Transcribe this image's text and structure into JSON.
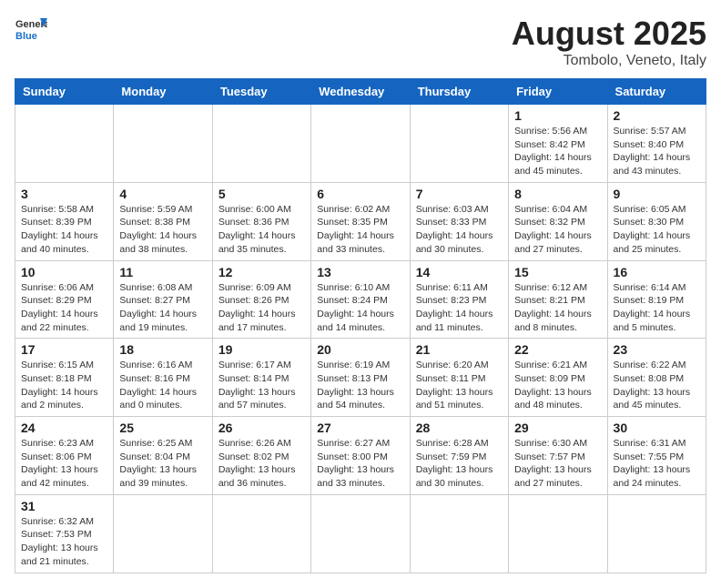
{
  "logo": {
    "text_general": "General",
    "text_blue": "Blue"
  },
  "title": "August 2025",
  "subtitle": "Tombolo, Veneto, Italy",
  "days_of_week": [
    "Sunday",
    "Monday",
    "Tuesday",
    "Wednesday",
    "Thursday",
    "Friday",
    "Saturday"
  ],
  "weeks": [
    [
      {
        "day": "",
        "info": ""
      },
      {
        "day": "",
        "info": ""
      },
      {
        "day": "",
        "info": ""
      },
      {
        "day": "",
        "info": ""
      },
      {
        "day": "",
        "info": ""
      },
      {
        "day": "1",
        "info": "Sunrise: 5:56 AM\nSunset: 8:42 PM\nDaylight: 14 hours and 45 minutes."
      },
      {
        "day": "2",
        "info": "Sunrise: 5:57 AM\nSunset: 8:40 PM\nDaylight: 14 hours and 43 minutes."
      }
    ],
    [
      {
        "day": "3",
        "info": "Sunrise: 5:58 AM\nSunset: 8:39 PM\nDaylight: 14 hours and 40 minutes."
      },
      {
        "day": "4",
        "info": "Sunrise: 5:59 AM\nSunset: 8:38 PM\nDaylight: 14 hours and 38 minutes."
      },
      {
        "day": "5",
        "info": "Sunrise: 6:00 AM\nSunset: 8:36 PM\nDaylight: 14 hours and 35 minutes."
      },
      {
        "day": "6",
        "info": "Sunrise: 6:02 AM\nSunset: 8:35 PM\nDaylight: 14 hours and 33 minutes."
      },
      {
        "day": "7",
        "info": "Sunrise: 6:03 AM\nSunset: 8:33 PM\nDaylight: 14 hours and 30 minutes."
      },
      {
        "day": "8",
        "info": "Sunrise: 6:04 AM\nSunset: 8:32 PM\nDaylight: 14 hours and 27 minutes."
      },
      {
        "day": "9",
        "info": "Sunrise: 6:05 AM\nSunset: 8:30 PM\nDaylight: 14 hours and 25 minutes."
      }
    ],
    [
      {
        "day": "10",
        "info": "Sunrise: 6:06 AM\nSunset: 8:29 PM\nDaylight: 14 hours and 22 minutes."
      },
      {
        "day": "11",
        "info": "Sunrise: 6:08 AM\nSunset: 8:27 PM\nDaylight: 14 hours and 19 minutes."
      },
      {
        "day": "12",
        "info": "Sunrise: 6:09 AM\nSunset: 8:26 PM\nDaylight: 14 hours and 17 minutes."
      },
      {
        "day": "13",
        "info": "Sunrise: 6:10 AM\nSunset: 8:24 PM\nDaylight: 14 hours and 14 minutes."
      },
      {
        "day": "14",
        "info": "Sunrise: 6:11 AM\nSunset: 8:23 PM\nDaylight: 14 hours and 11 minutes."
      },
      {
        "day": "15",
        "info": "Sunrise: 6:12 AM\nSunset: 8:21 PM\nDaylight: 14 hours and 8 minutes."
      },
      {
        "day": "16",
        "info": "Sunrise: 6:14 AM\nSunset: 8:19 PM\nDaylight: 14 hours and 5 minutes."
      }
    ],
    [
      {
        "day": "17",
        "info": "Sunrise: 6:15 AM\nSunset: 8:18 PM\nDaylight: 14 hours and 2 minutes."
      },
      {
        "day": "18",
        "info": "Sunrise: 6:16 AM\nSunset: 8:16 PM\nDaylight: 14 hours and 0 minutes."
      },
      {
        "day": "19",
        "info": "Sunrise: 6:17 AM\nSunset: 8:14 PM\nDaylight: 13 hours and 57 minutes."
      },
      {
        "day": "20",
        "info": "Sunrise: 6:19 AM\nSunset: 8:13 PM\nDaylight: 13 hours and 54 minutes."
      },
      {
        "day": "21",
        "info": "Sunrise: 6:20 AM\nSunset: 8:11 PM\nDaylight: 13 hours and 51 minutes."
      },
      {
        "day": "22",
        "info": "Sunrise: 6:21 AM\nSunset: 8:09 PM\nDaylight: 13 hours and 48 minutes."
      },
      {
        "day": "23",
        "info": "Sunrise: 6:22 AM\nSunset: 8:08 PM\nDaylight: 13 hours and 45 minutes."
      }
    ],
    [
      {
        "day": "24",
        "info": "Sunrise: 6:23 AM\nSunset: 8:06 PM\nDaylight: 13 hours and 42 minutes."
      },
      {
        "day": "25",
        "info": "Sunrise: 6:25 AM\nSunset: 8:04 PM\nDaylight: 13 hours and 39 minutes."
      },
      {
        "day": "26",
        "info": "Sunrise: 6:26 AM\nSunset: 8:02 PM\nDaylight: 13 hours and 36 minutes."
      },
      {
        "day": "27",
        "info": "Sunrise: 6:27 AM\nSunset: 8:00 PM\nDaylight: 13 hours and 33 minutes."
      },
      {
        "day": "28",
        "info": "Sunrise: 6:28 AM\nSunset: 7:59 PM\nDaylight: 13 hours and 30 minutes."
      },
      {
        "day": "29",
        "info": "Sunrise: 6:30 AM\nSunset: 7:57 PM\nDaylight: 13 hours and 27 minutes."
      },
      {
        "day": "30",
        "info": "Sunrise: 6:31 AM\nSunset: 7:55 PM\nDaylight: 13 hours and 24 minutes."
      }
    ],
    [
      {
        "day": "31",
        "info": "Sunrise: 6:32 AM\nSunset: 7:53 PM\nDaylight: 13 hours and 21 minutes."
      },
      {
        "day": "",
        "info": ""
      },
      {
        "day": "",
        "info": ""
      },
      {
        "day": "",
        "info": ""
      },
      {
        "day": "",
        "info": ""
      },
      {
        "day": "",
        "info": ""
      },
      {
        "day": "",
        "info": ""
      }
    ]
  ]
}
